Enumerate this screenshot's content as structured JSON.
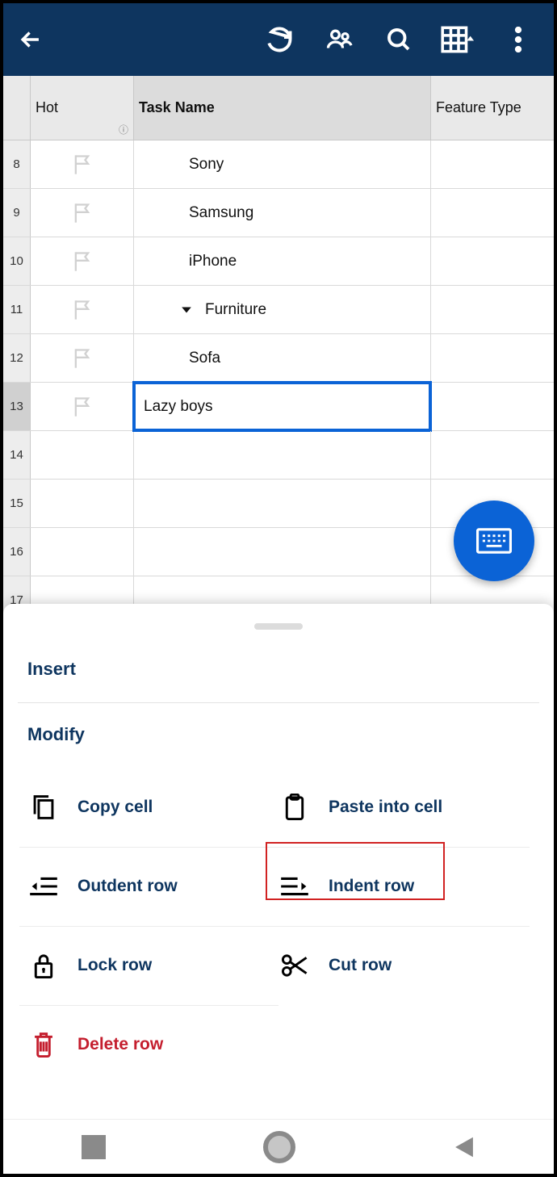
{
  "columns": {
    "hot": "Hot",
    "task": "Task Name",
    "feature": "Feature Type"
  },
  "rows": [
    {
      "num": "8",
      "flag": true,
      "indent": 2,
      "caret": false,
      "label": "Sony",
      "selected": false
    },
    {
      "num": "9",
      "flag": true,
      "indent": 2,
      "caret": false,
      "label": "Samsung",
      "selected": false
    },
    {
      "num": "10",
      "flag": true,
      "indent": 2,
      "caret": false,
      "label": "iPhone",
      "selected": false
    },
    {
      "num": "11",
      "flag": true,
      "indent": 1,
      "caret": true,
      "label": "Furniture",
      "selected": false
    },
    {
      "num": "12",
      "flag": true,
      "indent": 2,
      "caret": false,
      "label": "Sofa",
      "selected": false
    },
    {
      "num": "13",
      "flag": true,
      "indent": 2,
      "caret": false,
      "label": "Lazy boys",
      "selected": true
    },
    {
      "num": "14",
      "flag": false,
      "indent": 0,
      "caret": false,
      "label": "",
      "selected": false
    },
    {
      "num": "15",
      "flag": false,
      "indent": 0,
      "caret": false,
      "label": "",
      "selected": false
    },
    {
      "num": "16",
      "flag": false,
      "indent": 0,
      "caret": false,
      "label": "",
      "selected": false
    },
    {
      "num": "17",
      "flag": false,
      "indent": 0,
      "caret": false,
      "label": "",
      "selected": false
    }
  ],
  "sheet": {
    "insert": "Insert",
    "modify": "Modify",
    "actions": {
      "copy": "Copy cell",
      "paste": "Paste into cell",
      "outdent": "Outdent row",
      "indent": "Indent row",
      "lock": "Lock row",
      "cut": "Cut row",
      "delete": "Delete row"
    },
    "highlighted_action": "indent"
  }
}
